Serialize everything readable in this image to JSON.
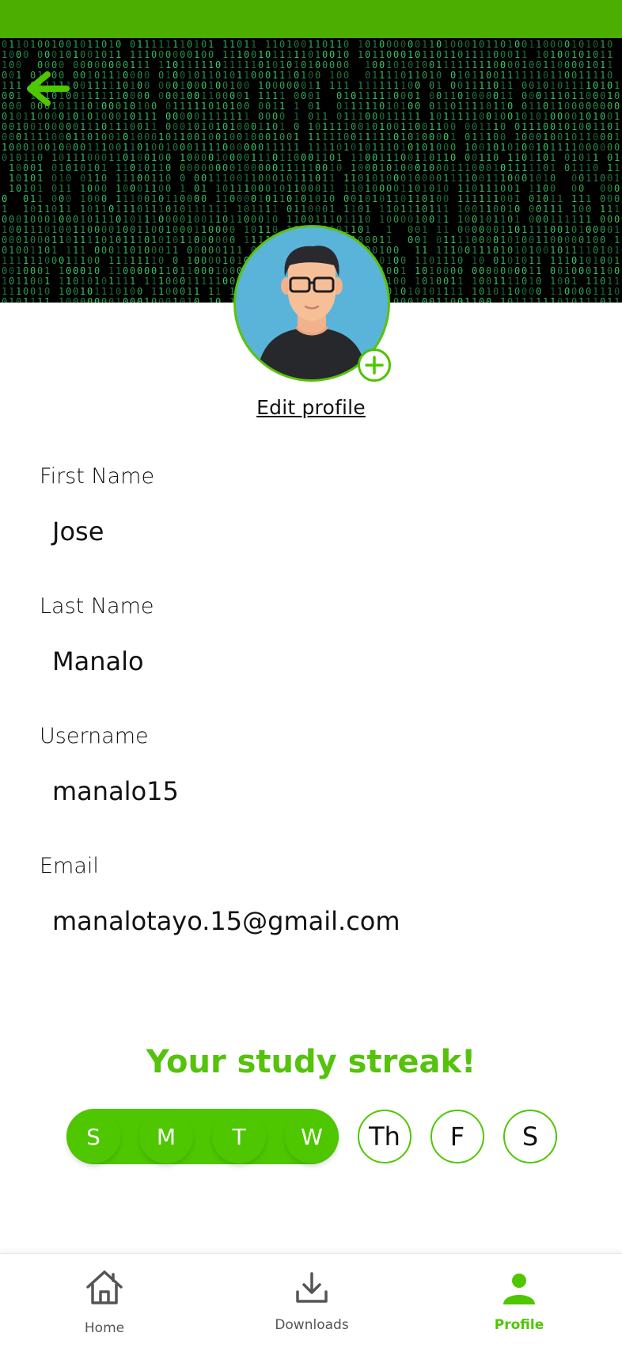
{
  "colors": {
    "accent": "#4ec700",
    "status_bar": "#4caf00",
    "banner_bg": "#000000",
    "matrix_text": "#3ecf6a",
    "avatar_bg": "#5ab4d9",
    "nav_inactive": "#555555"
  },
  "header": {
    "back_icon": "arrow-left-icon",
    "banner_pattern": "binary-matrix-rain",
    "binary_digits": [
      "0",
      "1"
    ]
  },
  "profile": {
    "avatar_icon": "user-avatar-with-glasses",
    "add_photo_icon": "plus-circle-icon",
    "edit_label": "Edit profile"
  },
  "fields": [
    {
      "label": "First Name",
      "value": "Jose"
    },
    {
      "label": "Last Name",
      "value": "Manalo"
    },
    {
      "label": "Username",
      "value": "manalo15"
    },
    {
      "label": "Email",
      "value": "manalotayo.15@gmail.com"
    }
  ],
  "streak": {
    "title": "Your study streak!",
    "days": [
      {
        "label": "S",
        "done": true
      },
      {
        "label": "M",
        "done": true
      },
      {
        "label": "T",
        "done": true
      },
      {
        "label": "W",
        "done": true
      },
      {
        "label": "Th",
        "done": false
      },
      {
        "label": "F",
        "done": false
      },
      {
        "label": "S",
        "done": false
      }
    ]
  },
  "nav": {
    "items": [
      {
        "label": "Home",
        "icon": "home-icon",
        "active": false
      },
      {
        "label": "Downloads",
        "icon": "download-icon",
        "active": false
      },
      {
        "label": "Profile",
        "icon": "person-icon",
        "active": true
      }
    ]
  }
}
